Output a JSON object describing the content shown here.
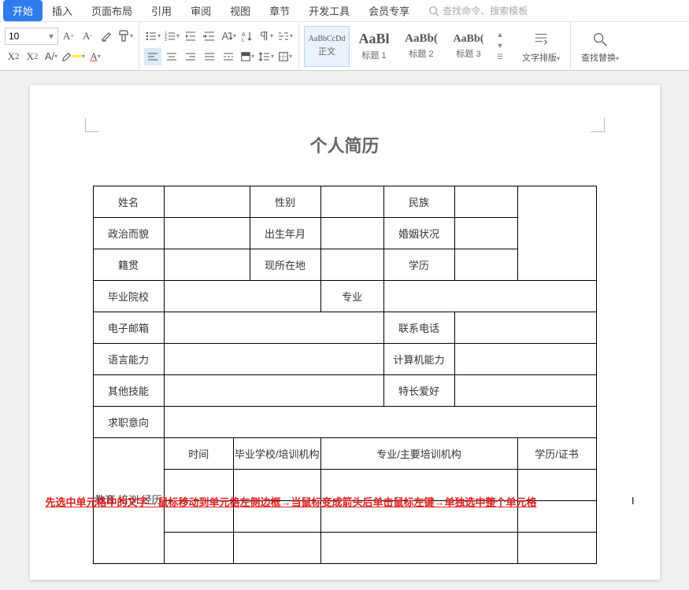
{
  "menu": {
    "tabs": [
      "开始",
      "插入",
      "页面布局",
      "引用",
      "审阅",
      "视图",
      "章节",
      "开发工具",
      "会员专享"
    ],
    "search_placeholder": "查找命令、搜索模板"
  },
  "ribbon": {
    "font_size": "10",
    "styles": [
      {
        "preview": "AaBbCcDd",
        "label": "正文",
        "size": "10px",
        "bold": false
      },
      {
        "preview": "AaBl",
        "label": "标题 1",
        "size": "18px",
        "bold": true
      },
      {
        "preview": "AaBb(",
        "label": "标题 2",
        "size": "15px",
        "bold": true
      },
      {
        "preview": "AaBb(",
        "label": "标题 3",
        "size": "14px",
        "bold": true
      }
    ],
    "text_layout": "文字排版",
    "find_replace": "查找替换"
  },
  "doc": {
    "title": "个人简历",
    "rows": {
      "r1": {
        "a": "姓名",
        "b": "性别",
        "c": "民族"
      },
      "r2": {
        "a": "政治而貌",
        "b": "出生年月",
        "c": "婚姻状况"
      },
      "r3": {
        "a": "籍贯",
        "b": "现所在地",
        "c": "学历"
      },
      "r4": {
        "a": "毕业院校",
        "b": "专业"
      },
      "r5": {
        "a": "电子邮箱",
        "b": "联系电话"
      },
      "r6": {
        "a": "语言能力",
        "b": "计算机能力"
      },
      "r7": {
        "a": "其他技能",
        "b": "特长爱好"
      },
      "r8": {
        "a": "求职意向"
      },
      "r9": {
        "side": "教育\n培训\n经历",
        "c1": "时间",
        "c2": "毕业学校/培训机构",
        "c3": "专业/主要培训机构",
        "c4": "学历/证书"
      }
    },
    "annotation": "先选中单元格中的文字→鼠标移动到单元格左侧边框→当鼠标变成箭头后单击鼠标左键→单独选中整个单元格"
  }
}
